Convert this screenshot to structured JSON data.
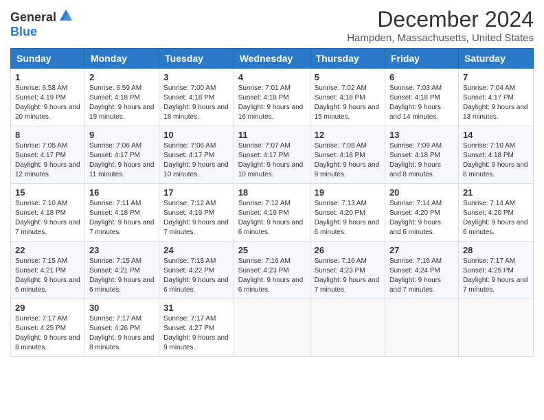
{
  "logo": {
    "general": "General",
    "blue": "Blue"
  },
  "title": "December 2024",
  "location": "Hampden, Massachusetts, United States",
  "headers": [
    "Sunday",
    "Monday",
    "Tuesday",
    "Wednesday",
    "Thursday",
    "Friday",
    "Saturday"
  ],
  "weeks": [
    [
      {
        "day": "1",
        "sunrise": "6:58 AM",
        "sunset": "4:19 PM",
        "daylight": "9 hours and 20 minutes."
      },
      {
        "day": "2",
        "sunrise": "6:59 AM",
        "sunset": "4:18 PM",
        "daylight": "9 hours and 19 minutes."
      },
      {
        "day": "3",
        "sunrise": "7:00 AM",
        "sunset": "4:18 PM",
        "daylight": "9 hours and 18 minutes."
      },
      {
        "day": "4",
        "sunrise": "7:01 AM",
        "sunset": "4:18 PM",
        "daylight": "9 hours and 16 minutes."
      },
      {
        "day": "5",
        "sunrise": "7:02 AM",
        "sunset": "4:18 PM",
        "daylight": "9 hours and 15 minutes."
      },
      {
        "day": "6",
        "sunrise": "7:03 AM",
        "sunset": "4:18 PM",
        "daylight": "9 hours and 14 minutes."
      },
      {
        "day": "7",
        "sunrise": "7:04 AM",
        "sunset": "4:17 PM",
        "daylight": "9 hours and 13 minutes."
      }
    ],
    [
      {
        "day": "8",
        "sunrise": "7:05 AM",
        "sunset": "4:17 PM",
        "daylight": "9 hours and 12 minutes."
      },
      {
        "day": "9",
        "sunrise": "7:06 AM",
        "sunset": "4:17 PM",
        "daylight": "9 hours and 11 minutes."
      },
      {
        "day": "10",
        "sunrise": "7:06 AM",
        "sunset": "4:17 PM",
        "daylight": "9 hours and 10 minutes."
      },
      {
        "day": "11",
        "sunrise": "7:07 AM",
        "sunset": "4:17 PM",
        "daylight": "9 hours and 10 minutes."
      },
      {
        "day": "12",
        "sunrise": "7:08 AM",
        "sunset": "4:18 PM",
        "daylight": "9 hours and 9 minutes."
      },
      {
        "day": "13",
        "sunrise": "7:09 AM",
        "sunset": "4:18 PM",
        "daylight": "9 hours and 8 minutes."
      },
      {
        "day": "14",
        "sunrise": "7:10 AM",
        "sunset": "4:18 PM",
        "daylight": "9 hours and 8 minutes."
      }
    ],
    [
      {
        "day": "15",
        "sunrise": "7:10 AM",
        "sunset": "4:18 PM",
        "daylight": "9 hours and 7 minutes."
      },
      {
        "day": "16",
        "sunrise": "7:11 AM",
        "sunset": "4:18 PM",
        "daylight": "9 hours and 7 minutes."
      },
      {
        "day": "17",
        "sunrise": "7:12 AM",
        "sunset": "4:19 PM",
        "daylight": "9 hours and 7 minutes."
      },
      {
        "day": "18",
        "sunrise": "7:12 AM",
        "sunset": "4:19 PM",
        "daylight": "9 hours and 6 minutes."
      },
      {
        "day": "19",
        "sunrise": "7:13 AM",
        "sunset": "4:20 PM",
        "daylight": "9 hours and 6 minutes."
      },
      {
        "day": "20",
        "sunrise": "7:14 AM",
        "sunset": "4:20 PM",
        "daylight": "9 hours and 6 minutes."
      },
      {
        "day": "21",
        "sunrise": "7:14 AM",
        "sunset": "4:20 PM",
        "daylight": "9 hours and 6 minutes."
      }
    ],
    [
      {
        "day": "22",
        "sunrise": "7:15 AM",
        "sunset": "4:21 PM",
        "daylight": "9 hours and 6 minutes."
      },
      {
        "day": "23",
        "sunrise": "7:15 AM",
        "sunset": "4:21 PM",
        "daylight": "9 hours and 6 minutes."
      },
      {
        "day": "24",
        "sunrise": "7:15 AM",
        "sunset": "4:22 PM",
        "daylight": "9 hours and 6 minutes."
      },
      {
        "day": "25",
        "sunrise": "7:16 AM",
        "sunset": "4:23 PM",
        "daylight": "9 hours and 6 minutes."
      },
      {
        "day": "26",
        "sunrise": "7:16 AM",
        "sunset": "4:23 PM",
        "daylight": "9 hours and 7 minutes."
      },
      {
        "day": "27",
        "sunrise": "7:16 AM",
        "sunset": "4:24 PM",
        "daylight": "9 hours and 7 minutes."
      },
      {
        "day": "28",
        "sunrise": "7:17 AM",
        "sunset": "4:25 PM",
        "daylight": "9 hours and 7 minutes."
      }
    ],
    [
      {
        "day": "29",
        "sunrise": "7:17 AM",
        "sunset": "4:25 PM",
        "daylight": "9 hours and 8 minutes."
      },
      {
        "day": "30",
        "sunrise": "7:17 AM",
        "sunset": "4:26 PM",
        "daylight": "9 hours and 8 minutes."
      },
      {
        "day": "31",
        "sunrise": "7:17 AM",
        "sunset": "4:27 PM",
        "daylight": "9 hours and 9 minutes."
      },
      null,
      null,
      null,
      null
    ]
  ],
  "labels": {
    "sunrise": "Sunrise:",
    "sunset": "Sunset:",
    "daylight": "Daylight:"
  }
}
